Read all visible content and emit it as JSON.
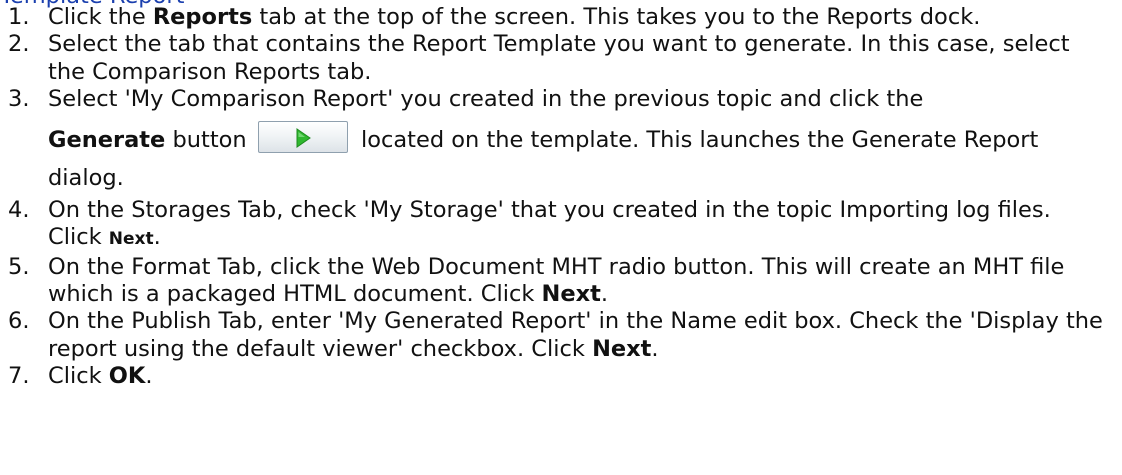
{
  "top_fragment": "Template Report",
  "steps": [
    {
      "num": "1.",
      "a": "Click the ",
      "b1": "Reports",
      "c": " tab at the top of the screen. This takes you to the Reports dock."
    },
    {
      "num": "2.",
      "a": "Select the tab that contains the Report Template you want to generate.  In this case, select the Comparison Reports tab."
    },
    {
      "num": "3.",
      "a": "Select 'My Comparison Report' you created in the previous topic and click the",
      "b1": "Generate",
      "c": " button ",
      "d": " located on the template. This launches the Generate Report dialog."
    },
    {
      "num": "4.",
      "a": "On the Storages Tab, check 'My Storage' that you created in the topic Importing log files. Click ",
      "b1": "Next",
      "c": "."
    },
    {
      "num": "5.",
      "a": "On the Format Tab, click the Web Document MHT radio button. This will create an MHT file which is a packaged HTML document. Click ",
      "b1": "Next",
      "c": "."
    },
    {
      "num": "6.",
      "a": "On the Publish Tab, enter 'My Generated Report' in the Name edit box. Check the 'Display the report using the default viewer' checkbox. Click ",
      "b1": "Next",
      "c": "."
    },
    {
      "num": "7.",
      "a": "Click ",
      "b1": "OK",
      "c": "."
    }
  ],
  "icons": {
    "generate_button": "green-play-arrow-icon"
  },
  "colors": {
    "play_green": "#2fb82f",
    "fragment_blue": "#1a3fae"
  }
}
